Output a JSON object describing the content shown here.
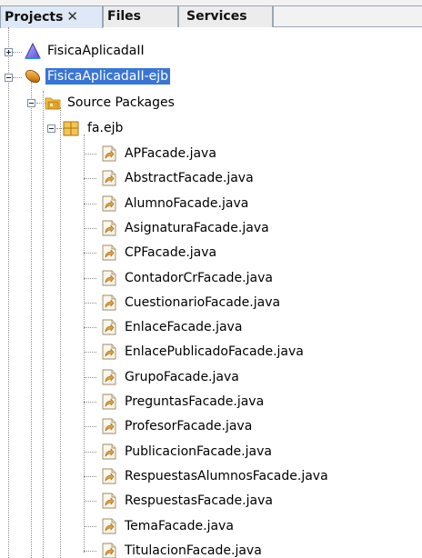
{
  "tabs": [
    {
      "label": "Projects",
      "close": "✕",
      "active": true
    },
    {
      "label": "Files",
      "active": false
    },
    {
      "label": "Services",
      "active": false
    }
  ],
  "tree": {
    "projects": [
      {
        "label": "FisicaAplicadaII",
        "icon": "web-project-icon",
        "expanded": false
      },
      {
        "label": "FisicaAplicadaII-ejb",
        "icon": "ejb-project-icon",
        "expanded": true,
        "selected": true
      }
    ],
    "source_packages": {
      "label": "Source Packages",
      "icon": "source-packages-icon",
      "expanded": true
    },
    "package": {
      "label": "fa.ejb",
      "icon": "package-icon",
      "expanded": true
    },
    "files": [
      "APFacade.java",
      "AbstractFacade.java",
      "AlumnoFacade.java",
      "AsignaturaFacade.java",
      "CPFacade.java",
      "ContadorCrFacade.java",
      "CuestionarioFacade.java",
      "EnlaceFacade.java",
      "EnlacePublicadoFacade.java",
      "GrupoFacade.java",
      "PreguntasFacade.java",
      "ProfesorFacade.java",
      "PublicacionFacade.java",
      "RespuestasAlumnosFacade.java",
      "RespuestasFacade.java",
      "TemaFacade.java",
      "TitulacionFacade.java"
    ],
    "file_icon": "java-file-icon"
  },
  "colors": {
    "selection": "#3875d7",
    "tab_active": "#dfe8f6",
    "tab_border": "#9aa6b4"
  }
}
